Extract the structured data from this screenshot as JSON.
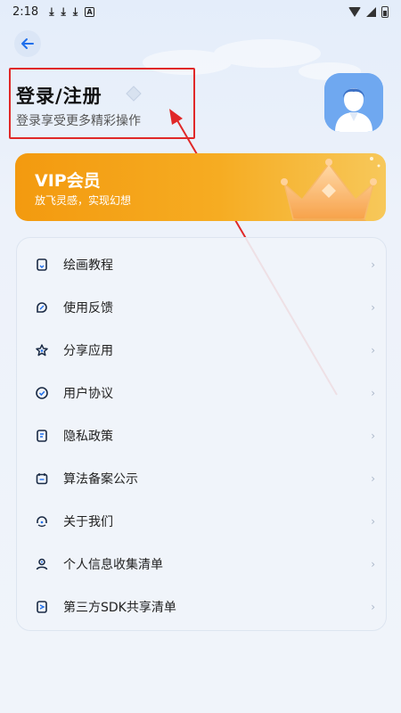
{
  "status_bar": {
    "time": "2:18",
    "icons": [
      "download-icon",
      "download-icon",
      "download-icon",
      "a-icon",
      "wifi-icon",
      "cell-signal-icon",
      "battery-icon"
    ]
  },
  "header": {
    "back_icon": "arrow-left-icon",
    "login_title": "登录/注册",
    "login_subtitle": "登录享受更多精彩操作"
  },
  "vip": {
    "title": "VIP会员",
    "subtitle": "放飞灵感，实现幻想"
  },
  "menu": {
    "items": [
      {
        "label": "绘画教程",
        "icon": "bookmark-icon"
      },
      {
        "label": "使用反馈",
        "icon": "feedback-icon"
      },
      {
        "label": "分享应用",
        "icon": "star-icon"
      },
      {
        "label": "用户协议",
        "icon": "check-circle-icon"
      },
      {
        "label": "隐私政策",
        "icon": "document-icon"
      },
      {
        "label": "算法备案公示",
        "icon": "calendar-icon"
      },
      {
        "label": "关于我们",
        "icon": "headset-icon"
      },
      {
        "label": "个人信息收集清单",
        "icon": "person-icon"
      },
      {
        "label": "第三方SDK共享清单",
        "icon": "share-doc-icon"
      }
    ]
  },
  "colors": {
    "accent": "#1f6feb",
    "vip_gradient_start": "#f39a0f",
    "vip_gradient_end": "#f7c85a",
    "highlight_red": "#e02828"
  }
}
